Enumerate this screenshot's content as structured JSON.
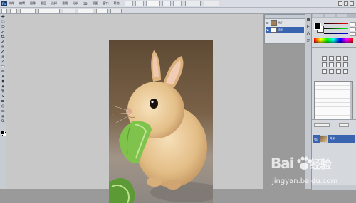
{
  "menubar": {
    "logo": "Ps",
    "items": [
      "文件",
      "编辑",
      "图像",
      "图层",
      "选择",
      "滤镜",
      "分析",
      "3D",
      "视图",
      "窗口",
      "帮助"
    ]
  },
  "layers_mini": {
    "rows": [
      {
        "name": "兔子"
      },
      {
        "name": "背景"
      }
    ]
  },
  "layers_panel": {
    "layer_name": "背景"
  },
  "watermark": {
    "brand": "Bai",
    "brand_suffix": "经验",
    "site": "jingyan.baidu.com"
  },
  "colors": {
    "workspace": "#c8c8c8",
    "selection": "#3b64b0"
  }
}
